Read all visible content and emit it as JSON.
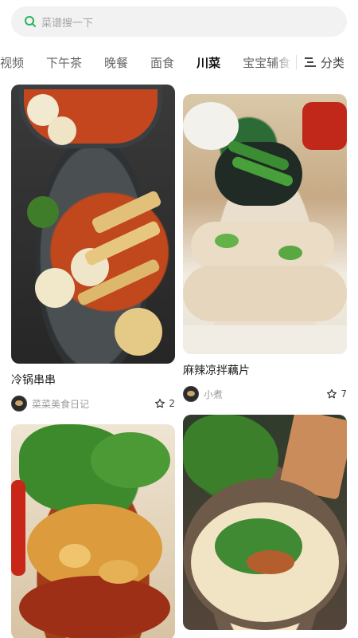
{
  "search": {
    "placeholder": "菜谱搜一下"
  },
  "tabs": {
    "items": [
      "视频",
      "下午茶",
      "晚餐",
      "面食",
      "川菜",
      "宝宝辅食"
    ],
    "active": "川菜",
    "category_label": "分类"
  },
  "cards": [
    {
      "title": "冷锅串串",
      "author": "菜菜美食日记",
      "likes": "2"
    },
    {
      "title": "麻辣凉拌藕片",
      "author": "小煮",
      "likes": "7"
    },
    {
      "title": "",
      "author": "",
      "likes": ""
    },
    {
      "title": "",
      "author": "",
      "likes": ""
    }
  ],
  "colors": {
    "accent": "#29b35a",
    "text": "#222222",
    "muted": "#9b9b9b"
  },
  "icons": {
    "search": "search-icon",
    "menu": "list-menu-icon",
    "star": "star-outline-icon"
  }
}
